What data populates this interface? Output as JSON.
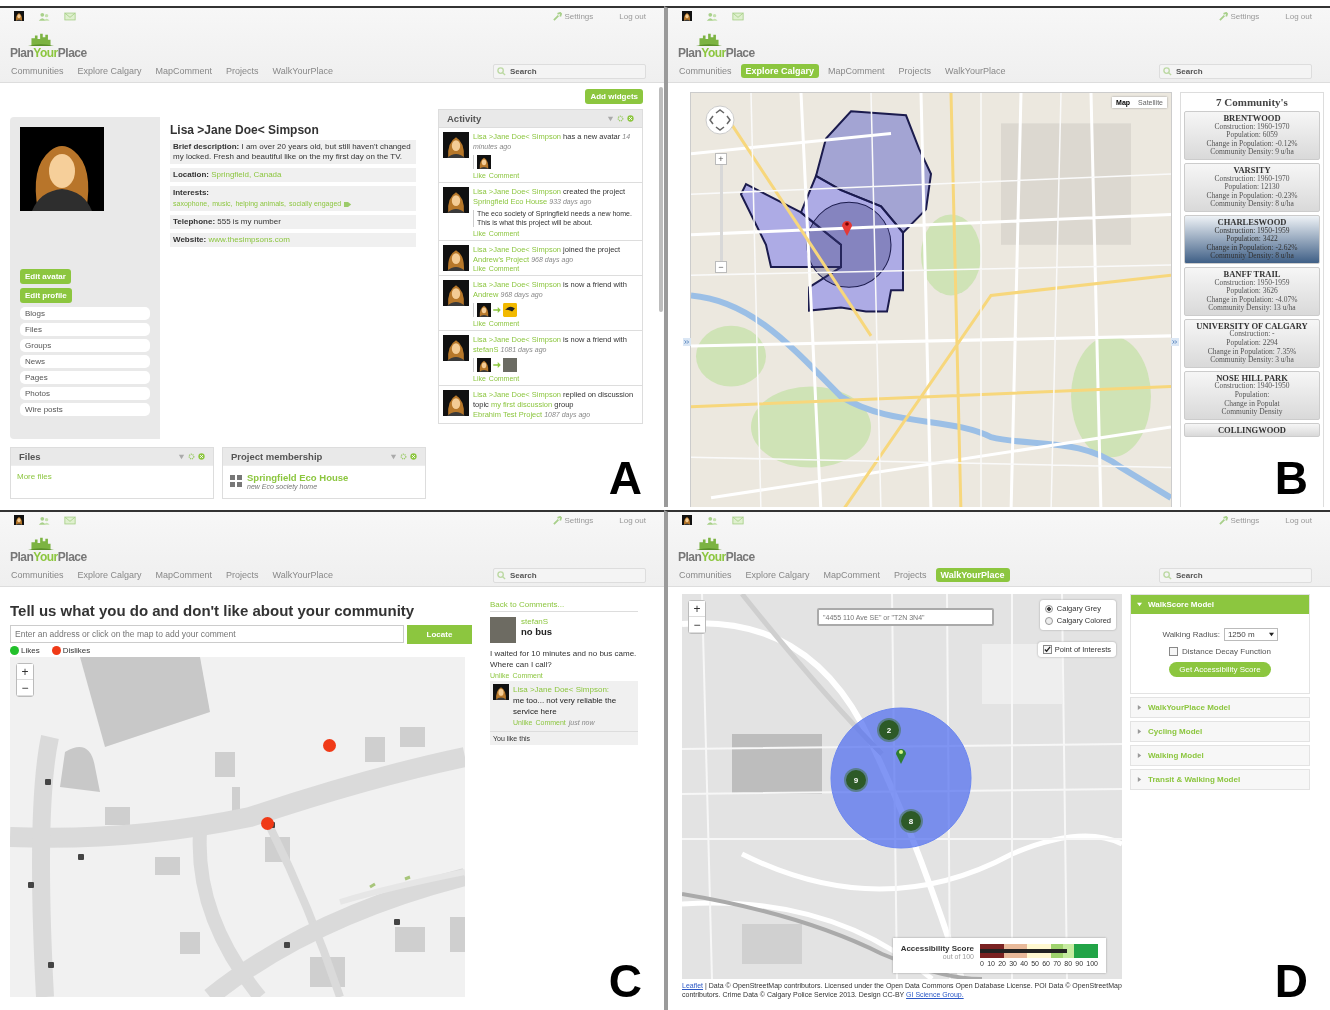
{
  "panels": [
    {
      "label": "A",
      "kind": "profile",
      "header": {
        "settings": "Settings",
        "logout": "Log out",
        "logo": [
          "Plan",
          "Your",
          "Place"
        ],
        "nav": [
          {
            "label": "Communities",
            "selected": false
          },
          {
            "label": "Explore Calgary",
            "selected": false
          },
          {
            "label": "MapComment",
            "selected": false
          },
          {
            "label": "Projects",
            "selected": false
          },
          {
            "label": "WalkYourPlace",
            "selected": false
          }
        ],
        "search": {
          "placeholder": "Search"
        }
      },
      "profile": {
        "name": "Lisa >Jane Doe< Simpson",
        "buttons": [
          "Edit avatar",
          "Edit profile"
        ],
        "menu": [
          "Blogs",
          "Files",
          "Groups",
          "News",
          "Pages",
          "Photos",
          "Wire posts"
        ],
        "fields": [
          {
            "kind": "text",
            "label": "Brief description:",
            "value": "I am over 20 years old, but still haven't changed my locked. Fresh and beautiful like on the my first day on the TV."
          },
          {
            "kind": "link",
            "label": "Location:",
            "value": "Springfield, Canada"
          },
          {
            "kind": "tags",
            "label": "Interests:",
            "tags": [
              "saxophone,",
              "music,",
              "helping animals,",
              "socially engaged"
            ]
          },
          {
            "kind": "text",
            "label": "Telephone:",
            "value": "555 is my number"
          },
          {
            "kind": "link",
            "label": "Website:",
            "value": "www.thesimpsons.com"
          }
        ]
      },
      "widgets": [
        {
          "kind": "files",
          "title": "Files",
          "link": "More files"
        },
        {
          "kind": "projects",
          "title": "Project membership",
          "projects": [
            {
              "name": "Springfield Eco House",
              "description": "new Eco society home"
            }
          ]
        }
      ],
      "add_widgets": "Add widgets",
      "activity": {
        "title": "Activity",
        "items": [
          {
            "kind": "avatar",
            "parts": [
              {
                "text": "Lisa >Jane Doe< Simpson",
                "kind": "link"
              },
              {
                "text": "has a new avatar",
                "kind": "text"
              }
            ],
            "time": "14 minutes ago",
            "actions": [
              "Like",
              "Comment"
            ]
          },
          {
            "kind": "quote",
            "parts": [
              {
                "text": "Lisa >Jane Doe< Simpson",
                "kind": "link"
              },
              {
                "text": "created the project",
                "kind": "text"
              },
              {
                "text": "Springfield Eco House",
                "kind": "link"
              }
            ],
            "time": "933 days ago",
            "quote": "The eco society of Springfield needs a new home. This is what this project will be about.",
            "actions": [
              "Like",
              "Comment"
            ]
          },
          {
            "kind": "plain",
            "parts": [
              {
                "text": "Lisa >Jane Doe< Simpson",
                "kind": "link"
              },
              {
                "text": "joined the project",
                "kind": "text"
              },
              {
                "text": "Andrew's Project",
                "kind": "link"
              }
            ],
            "time": "968 days ago",
            "actions": [
              "Like",
              "Comment"
            ]
          },
          {
            "kind": "friend_icon",
            "parts": [
              {
                "text": "Lisa >Jane Doe< Simpson",
                "kind": "link"
              },
              {
                "text": "is now a friend with",
                "kind": "text"
              },
              {
                "text": "Andrew",
                "kind": "link"
              }
            ],
            "time": "968 days ago",
            "actions": [
              "Like",
              "Comment"
            ]
          },
          {
            "kind": "friend_photo",
            "parts": [
              {
                "text": "Lisa >Jane Doe< Simpson",
                "kind": "link"
              },
              {
                "text": "is now a friend with",
                "kind": "text"
              },
              {
                "text": "stefanS",
                "kind": "link"
              }
            ],
            "time": "1081 days ago",
            "actions": [
              "Like",
              "Comment"
            ]
          },
          {
            "kind": "plain",
            "parts": [
              {
                "text": "Lisa >Jane Doe< Simpson",
                "kind": "link"
              },
              {
                "text": "replied on discussion topic",
                "kind": "text"
              },
              {
                "text": "my first discussion",
                "kind": "link"
              },
              {
                "text": "group",
                "kind": "text"
              },
              {
                "text": "Ebrahim Test Project",
                "kind": "link"
              }
            ],
            "time": "1087 days ago"
          }
        ]
      }
    },
    {
      "label": "B",
      "kind": "explore",
      "header": {
        "settings": "Settings",
        "logout": "Log out",
        "logo": [
          "Plan",
          "Your",
          "Place"
        ],
        "nav": [
          {
            "label": "Communities",
            "selected": false
          },
          {
            "label": "Explore Calgary",
            "selected": true
          },
          {
            "label": "MapComment",
            "selected": false
          },
          {
            "label": "Projects",
            "selected": false
          },
          {
            "label": "WalkYourPlace",
            "selected": false
          }
        ],
        "search": {
          "placeholder": "Search"
        }
      },
      "zoom": [
        "+",
        "−"
      ],
      "map_types": [
        {
          "label": "Map",
          "selected": true
        },
        {
          "label": "Satellite",
          "selected": false
        }
      ],
      "communities": {
        "title": "7 Community's",
        "items": [
          {
            "name": "BRENTWOOD",
            "selected": false,
            "lines": [
              "Construction: 1960-1970",
              "Population: 6059",
              "Change in Population: -0.12%",
              "Community Density: 9 u/ha"
            ]
          },
          {
            "name": "VARSITY",
            "selected": false,
            "lines": [
              "Construction: 1960-1970",
              "Population: 12130",
              "Change in Population: -0.23%",
              "Community Density: 8 u/ha"
            ]
          },
          {
            "name": "CHARLESWOOD",
            "selected": true,
            "lines": [
              "Construction: 1950-1959",
              "Population: 3422",
              "Change in Population: -2.62%",
              "Community Density: 8 u/ha"
            ]
          },
          {
            "name": "BANFF TRAIL",
            "selected": false,
            "lines": [
              "Construction: 1950-1959",
              "Population: 3626",
              "Change in Population: -4.07%",
              "Community Density: 13 u/ha"
            ]
          },
          {
            "name": "UNIVERSITY OF CALGARY",
            "selected": false,
            "lines": [
              "Construction: -",
              "Population: 2294",
              "Change in Population: 7.35%",
              "Community Density: 3 u/ha"
            ]
          },
          {
            "name": "NOSE HILL PARK",
            "selected": false,
            "lines": [
              "Construction: 1940-1950",
              "Population:",
              "Change in Populat",
              "Community Density"
            ]
          },
          {
            "name": "COLLINGWOOD",
            "selected": false
          }
        ]
      }
    },
    {
      "label": "C",
      "kind": "mapcomment",
      "header": {
        "settings": "Settings",
        "logout": "Log out",
        "logo": [
          "Plan",
          "Your",
          "Place"
        ],
        "nav": [
          {
            "label": "Communities",
            "selected": false
          },
          {
            "label": "Explore Calgary",
            "selected": false
          },
          {
            "label": "MapComment",
            "selected": false
          },
          {
            "label": "Projects",
            "selected": false
          },
          {
            "label": "WalkYourPlace",
            "selected": false
          }
        ],
        "search": {
          "placeholder": "Search"
        }
      },
      "title": "Tell us what you do and don't like about your community",
      "address": {
        "placeholder": "Enter an address or click on the map to add your comment"
      },
      "locate": "Locate",
      "legend": [
        {
          "label": "Likes",
          "color": "#22c02a"
        },
        {
          "label": "Dislikes",
          "color": "#f03a17"
        }
      ],
      "zoom": [
        "+",
        "−"
      ],
      "back": "Back to Comments...",
      "comment": {
        "user": "stefanS",
        "title": "no bus",
        "body": "I waited for 10 minutes and no bus came. Where can I call?",
        "actions": [
          "Unlike",
          "Comment"
        ],
        "reply": {
          "user": "Lisa >Jane Doe< Simpson:",
          "body": "me too... not very reliable the service here",
          "actions": [
            "Unlike",
            "Comment"
          ],
          "time": "just now"
        },
        "likes": "You like this"
      }
    },
    {
      "label": "D",
      "kind": "walk",
      "header": {
        "settings": "Settings",
        "logout": "Log out",
        "logo": [
          "Plan",
          "Your",
          "Place"
        ],
        "nav": [
          {
            "label": "Communities",
            "selected": false
          },
          {
            "label": "Explore Calgary",
            "selected": false
          },
          {
            "label": "MapComment",
            "selected": false
          },
          {
            "label": "Projects",
            "selected": false
          },
          {
            "label": "WalkYourPlace",
            "selected": true
          }
        ],
        "search": {
          "placeholder": "Search"
        }
      },
      "zoom": [
        "+",
        "−"
      ],
      "map_search": {
        "placeholder": "\"4455 110 Ave SE\" or \"T2N 3N4\""
      },
      "layers": [
        {
          "label": "Calgary Grey",
          "selected": true
        },
        {
          "label": "Calgary Colored",
          "selected": false
        }
      ],
      "poi": {
        "label": "Point of Interests",
        "checked": true
      },
      "clusters": [
        "2",
        "9",
        "8"
      ],
      "score": {
        "title": "Accessibility Score",
        "subtitle": "out of 100",
        "level": 0.72,
        "ticks": [
          "0",
          "10",
          "20",
          "30",
          "40",
          "50",
          "60",
          "70",
          "80",
          "90",
          "100"
        ]
      },
      "attribution": {
        "link": "Leaflet",
        "text": "| Data © OpenStreetMap contributors. Licensed under the Open Data Commons Open Database License. POI Data © OpenStreetMap contributors. Crime Data © Calgary Police Service 2013. Design CC-BY",
        "link2": "GI Science Group."
      },
      "models": [
        {
          "title": "WalkScore Model",
          "expanded": true
        },
        {
          "title": "WalkYourPlace Model",
          "expanded": false
        },
        {
          "title": "Cycling Model",
          "expanded": false
        },
        {
          "title": "Walking Model",
          "expanded": false
        },
        {
          "title": "Transit & Walking Model",
          "expanded": false
        }
      ],
      "radius": {
        "label": "Walking Radius:",
        "value": "1250 m"
      },
      "decay": {
        "label": "Distance Decay Function",
        "checked": false
      },
      "score_button": "Get Accessibility Score"
    }
  ]
}
